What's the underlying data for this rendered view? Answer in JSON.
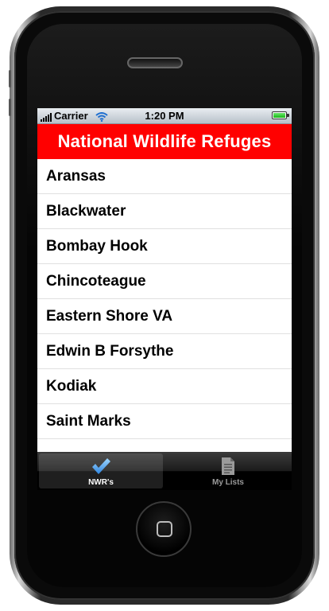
{
  "status_bar": {
    "carrier": "Carrier",
    "time": "1:20 PM"
  },
  "navbar": {
    "title": "National Wildlife Refuges"
  },
  "refuges": [
    "Aransas",
    "Blackwater",
    "Bombay Hook",
    "Chincoteague",
    "Eastern Shore VA",
    "Edwin B Forsythe",
    "Kodiak",
    "Saint Marks"
  ],
  "tabbar": {
    "tabs": [
      {
        "label": "NWR's",
        "icon": "checkmark-icon",
        "selected": true
      },
      {
        "label": "My Lists",
        "icon": "document-icon",
        "selected": false
      }
    ]
  },
  "colors": {
    "navbar": "#ff0000",
    "tab_selected_icon": "#4aa3f0"
  }
}
